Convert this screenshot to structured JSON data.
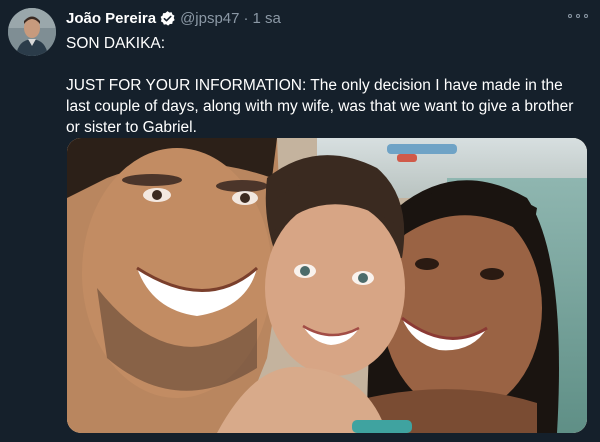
{
  "tweet": {
    "author": {
      "display_name": "João Pereira",
      "handle": "@jpsp47",
      "separator": "·",
      "time": "1 sa"
    },
    "text": {
      "line1": "SON DAKIKA:",
      "line2": "JUST FOR YOUR INFORMATION: The only decision I have made in the last couple of days, along with my wife, was that we want to give a brother or sister to Gabriel."
    }
  },
  "colors": {
    "background": "#15202b",
    "primary_text": "#ffffff",
    "secondary_text": "#8b98a5",
    "verified_badge": "#ffffff"
  },
  "icons": [
    "avatar",
    "verified-badge-icon",
    "more-options-icon"
  ]
}
